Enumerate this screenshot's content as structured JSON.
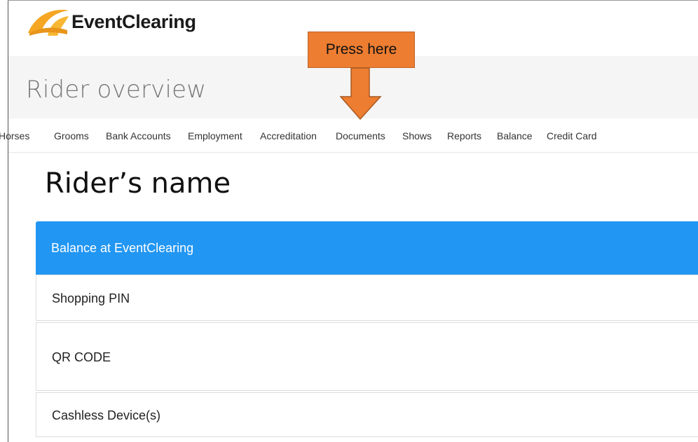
{
  "brand": {
    "name": "EventClearing"
  },
  "header": {
    "title": "Rider overview"
  },
  "callout": {
    "text": "Press here"
  },
  "nav": {
    "items": [
      "Horses",
      "Grooms",
      "Bank Accounts",
      "Employment",
      "Accreditation",
      "Documents",
      "Shows",
      "Reports",
      "Balance",
      "Credit Card"
    ]
  },
  "rider": {
    "name": "Rider’s name"
  },
  "panels": {
    "balance": "Balance at EventClearing",
    "shopping_pin": "Shopping PIN",
    "qr_code": "QR CODE",
    "cashless": "Cashless Device(s)"
  },
  "colors": {
    "accent": "#2196f3",
    "callout": "#ed7d31",
    "logo": "#f5a623"
  }
}
